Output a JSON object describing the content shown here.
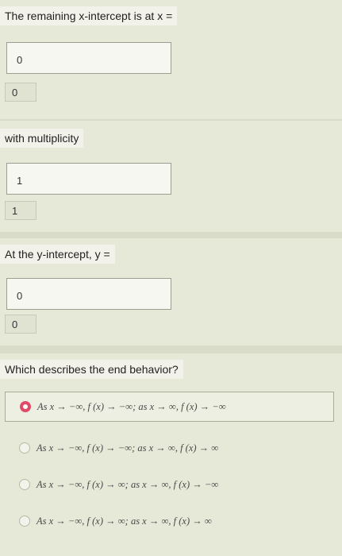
{
  "q1": {
    "label": "The remaining x-intercept is at x =",
    "input_value": "0",
    "echo": "0"
  },
  "q2": {
    "label": "with multiplicity",
    "input_value": "1",
    "echo": "1"
  },
  "q3": {
    "label": "At the y-intercept, y =",
    "input_value": "0",
    "echo": "0"
  },
  "q4": {
    "label": "Which describes the end behavior?",
    "options": [
      {
        "text": "As x → −∞, f (x) → −∞; as x → ∞, f (x) → −∞",
        "selected": true
      },
      {
        "text": "As x → −∞, f (x) → −∞; as x → ∞, f (x) → ∞",
        "selected": false
      },
      {
        "text": "As x → −∞, f (x) → ∞; as x → ∞, f (x) → −∞",
        "selected": false
      },
      {
        "text": "As x → −∞, f (x) → ∞; as x → ∞, f (x) → ∞",
        "selected": false
      }
    ]
  }
}
